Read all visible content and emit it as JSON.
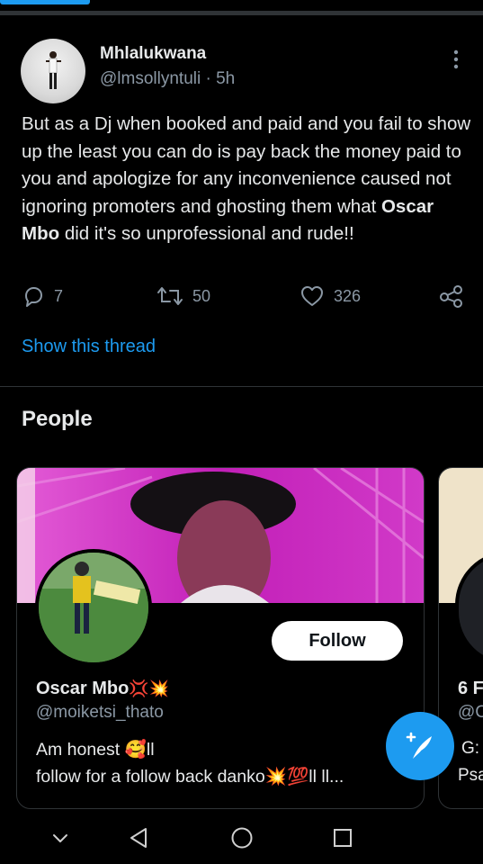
{
  "colors": {
    "accent": "#1d9bf0",
    "background": "#000000",
    "text": "#e7e9ea",
    "muted": "#8b98a5",
    "banner": "#c21fb8"
  },
  "tweet": {
    "author_name": "Mhlalukwana",
    "author_handle": "@lmsollyntuli · 5h",
    "text_before": "But as a Dj when booked and paid and you fail to show up the least you can do is pay back the money paid to you and apologize for any inconvenience caused not ignoring promoters and ghosting them what ",
    "text_bold": "Oscar Mbo",
    "text_after": " did it's so unprofessional and rude!!",
    "replies": "7",
    "retweets": "50",
    "likes": "326",
    "show_thread": "Show this thread"
  },
  "people": {
    "title": "People",
    "cards": [
      {
        "name": "Oscar Mbo",
        "name_emojis": "💢💥",
        "handle": "@moiketsi_thato",
        "bio_line1": "Am honest 🥰ll",
        "bio_line2": "follow for a follow back danko💥💯ll ll...",
        "follow_label": "Follow"
      },
      {
        "name": "6 F",
        "handle": "@C",
        "bio_line1": "G:",
        "bio_line2": "Psa"
      }
    ]
  },
  "icons": {
    "more": "more-vertical-icon",
    "reply": "reply-icon",
    "retweet": "retweet-icon",
    "like": "heart-icon",
    "share": "share-icon",
    "compose": "compose-tweet-icon",
    "nav_down": "chevron-down-icon",
    "nav_back": "back-triangle-icon",
    "nav_home": "home-circle-icon",
    "nav_recents": "recents-square-icon"
  }
}
